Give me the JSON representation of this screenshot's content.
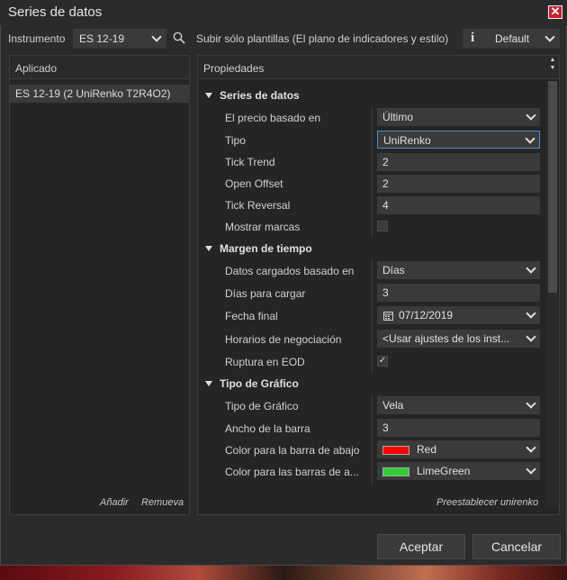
{
  "window": {
    "title": "Series de datos"
  },
  "toolbar": {
    "instrument_label": "Instrumento",
    "instrument_value": "ES 12-19",
    "upload_label": "Subir sólo plantillas (El plano de indicadores y estilo)",
    "template_value": "Default"
  },
  "applied": {
    "header": "Aplicado",
    "item": "ES 12-19 (2 UniRenko T2R4O2)",
    "add_link": "Añadir",
    "remove_link": "Remueva"
  },
  "properties": {
    "header": "Propiedades",
    "reset_link": "Preestablecer unirenko",
    "sections": {
      "data_series": "Series de datos",
      "time_frame": "Margen de tiempo",
      "chart_style": "Tipo de Gráfico"
    },
    "rows": {
      "price_based_label": "El precio basado en",
      "price_based_value": "Último",
      "type_label": "Tipo",
      "type_value": "UniRenko",
      "tick_trend_label": "Tick Trend",
      "tick_trend_value": "2",
      "open_offset_label": "Open Offset",
      "open_offset_value": "2",
      "tick_reversal_label": "Tick Reversal",
      "tick_reversal_value": "4",
      "show_ticks_label": "Mostrar marcas",
      "load_based_label": "Datos cargados basado en",
      "load_based_value": "Días",
      "days_label": "Días para cargar",
      "days_value": "3",
      "end_date_label": "Fecha final",
      "end_date_value": "07/12/2019",
      "trading_hours_label": "Horarios de negociación",
      "trading_hours_value": "<Usar ajustes de los inst...",
      "eod_label": "Ruptura en EOD",
      "chart_type_label": "Tipo de Gráfico",
      "chart_type_value": "Vela",
      "bar_width_label": "Ancho de la barra",
      "bar_width_value": "3",
      "down_color_label": "Color para la barra de abajo",
      "down_color_value": "Red",
      "up_color_label": "Color para las barras de a...",
      "up_color_value": "LimeGreen"
    }
  },
  "colors": {
    "down": "#ff0000",
    "up": "#32cd32"
  },
  "buttons": {
    "ok": "Aceptar",
    "cancel": "Cancelar"
  }
}
